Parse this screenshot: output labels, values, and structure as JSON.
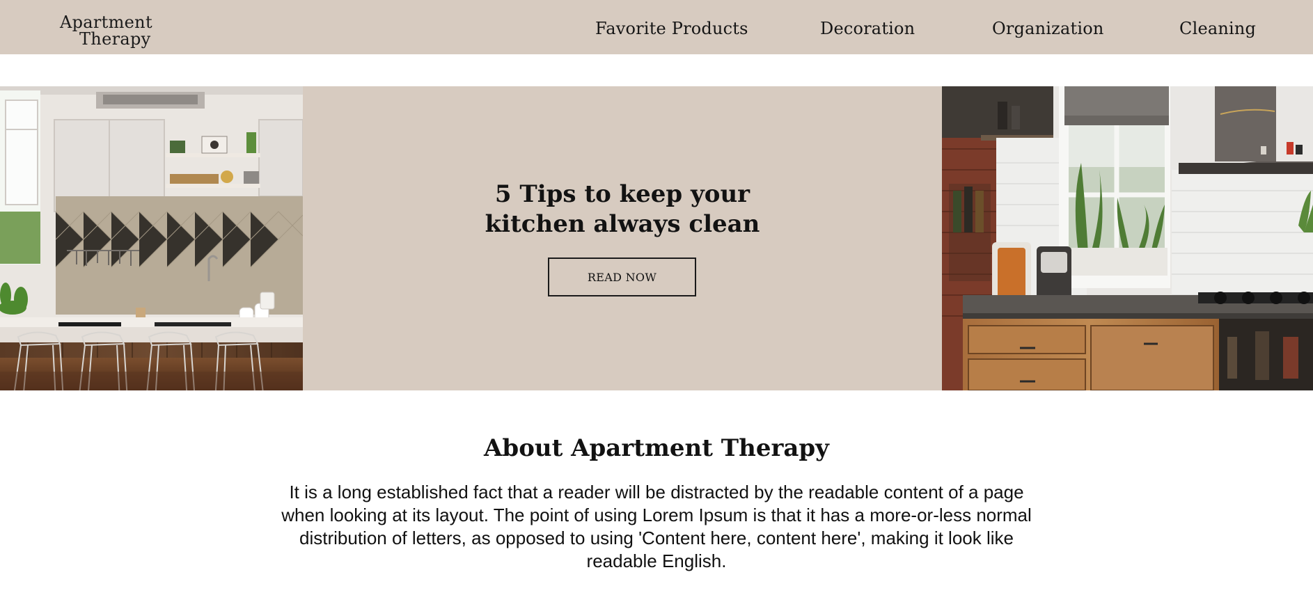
{
  "header": {
    "logo_line1": "Apartment",
    "logo_line2": "Therapy",
    "nav": [
      {
        "label": "Favorite Products"
      },
      {
        "label": "Decoration"
      },
      {
        "label": "Organization"
      },
      {
        "label": "Cleaning"
      }
    ]
  },
  "hero": {
    "title_line1": "5 Tips to keep your",
    "title_line2": "kitchen always clean",
    "button_label": "READ NOW",
    "left_image_icon": "kitchen-island-photo",
    "right_image_icon": "kitchen-window-photo"
  },
  "about": {
    "title": "About Apartment Therapy",
    "text": "It is a long established fact that a reader will be distracted by the readable content of a page when looking at its layout. The point of using Lorem Ipsum is that it has a more-or-less normal distribution of letters, as opposed to using 'Content here, content here', making it look like readable English."
  },
  "colors": {
    "beige": "#d7cbc0",
    "text": "#141414",
    "background": "#ffffff"
  }
}
